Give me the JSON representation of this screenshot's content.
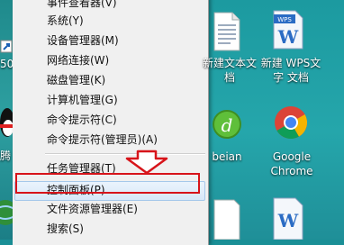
{
  "menu": {
    "items": [
      {
        "label": "事件查看器(V)"
      },
      {
        "label": "系统(Y)"
      },
      {
        "label": "设备管理器(M)"
      },
      {
        "label": "网络连接(W)"
      },
      {
        "label": "磁盘管理(K)"
      },
      {
        "label": "计算机管理(G)"
      },
      {
        "label": "命令提示符(C)"
      },
      {
        "label": "命令提示符(管理员)(A)"
      },
      {
        "label": "任务管理器(T)"
      },
      {
        "label": "控制面板(P)"
      },
      {
        "label": "文件资源管理器(E)"
      },
      {
        "label": "搜索(S)"
      }
    ]
  },
  "desktop": {
    "left_labels": [
      "50",
      "腾"
    ],
    "icons": [
      {
        "line1": "新建文本文",
        "line2": "档",
        "icon": "text-file-icon"
      },
      {
        "line1": "新建 WPS文",
        "line2": "字 文档",
        "icon": "wps-doc-icon"
      },
      {
        "line1": "beian",
        "line2": "",
        "icon": "dreamweaver-icon"
      },
      {
        "line1": "Google",
        "line2": "Chrome",
        "icon": "chrome-icon"
      }
    ],
    "wps_badge": "WPS"
  },
  "annotation": {
    "arrow_color": "#d7141a",
    "box_color": "#d7141a"
  }
}
